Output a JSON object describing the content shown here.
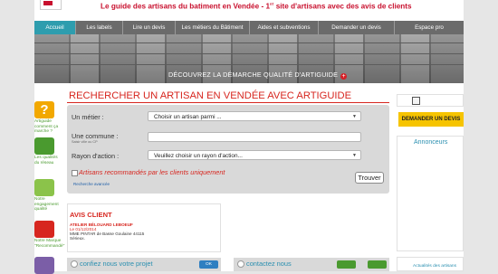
{
  "header": {
    "tagline_main": "Le guide des artisans du batiment en Vendée - 1",
    "tagline_sup": "er",
    "tagline_rest": " site d'artisans avec des avis de clients"
  },
  "nav": {
    "items": [
      {
        "label": "Accueil",
        "active": true
      },
      {
        "label": "Les labels",
        "active": false
      },
      {
        "label": "Lire un devis",
        "active": false
      },
      {
        "label": "Les métiers du Bâtiment",
        "active": false
      },
      {
        "label": "Aides et subventions",
        "active": false
      },
      {
        "label": "Demander un devis",
        "active": false
      },
      {
        "label": "Espace pro",
        "active": false
      }
    ]
  },
  "banner": {
    "caption": "DÉCOUVREZ LA DÉMARCHE QUALITÉ D'ARTIGUIDE",
    "plus": "+"
  },
  "left_icons": [
    {
      "label": "Artiguide comment ça marche ?",
      "color": "#f2a800",
      "icon": "question-icon"
    },
    {
      "label": "Les qualités du réseau",
      "color": "#4a9a2f",
      "icon": "network-icon"
    },
    {
      "label": "Notre engagement qualité",
      "color": "#8bc34a",
      "icon": "quality-icon"
    },
    {
      "label": "Notre Marque \"Recommandé\"",
      "color": "#d7261f",
      "icon": "brand-icon"
    },
    {
      "label": "",
      "color": "#7b5ea7",
      "icon": "chat-icon"
    }
  ],
  "search": {
    "title": "RECHERCHER UN ARTISAN EN VENDÉE AVEC ARTIGUIDE",
    "metier_label": "Un métier :",
    "metier_value": "Choisir un artisan parmi ...",
    "commune_label": "Une commune :",
    "commune_hint": "Saisir ville ou CP",
    "commune_value": "",
    "rayon_label": "Rayon d'action :",
    "rayon_value": "Veuillez choisir un rayon d'action...",
    "checkbox_label": "Artisans recommandés par les clients uniquement",
    "advanced_link": "Recherche avancée",
    "submit": "Trouver"
  },
  "avis": {
    "title": "AVIS CLIENT",
    "company": "ATELIER BÉLOUARD LEBOEUF",
    "date": "Le 01/12/2014",
    "who": "MME PINTAR de Basse Goulaine 44115",
    "place": "Sérieux."
  },
  "bottom": {
    "confiez_label": "confiez nous votre projet",
    "confiez_btn": "OK",
    "contact_label": "contactez nous",
    "contact_btn1": "",
    "contact_btn2": ""
  },
  "right": {
    "devis_button": "DEMANDER UN DEVIS",
    "annonceurs": "Annonceurs",
    "actualites": "Actualités des artisans"
  },
  "colors": {
    "brand_red": "#d7261f",
    "nav_active": "#2e9dae",
    "devis_yellow": "#f6c400",
    "link_blue": "#2a8fb0"
  }
}
